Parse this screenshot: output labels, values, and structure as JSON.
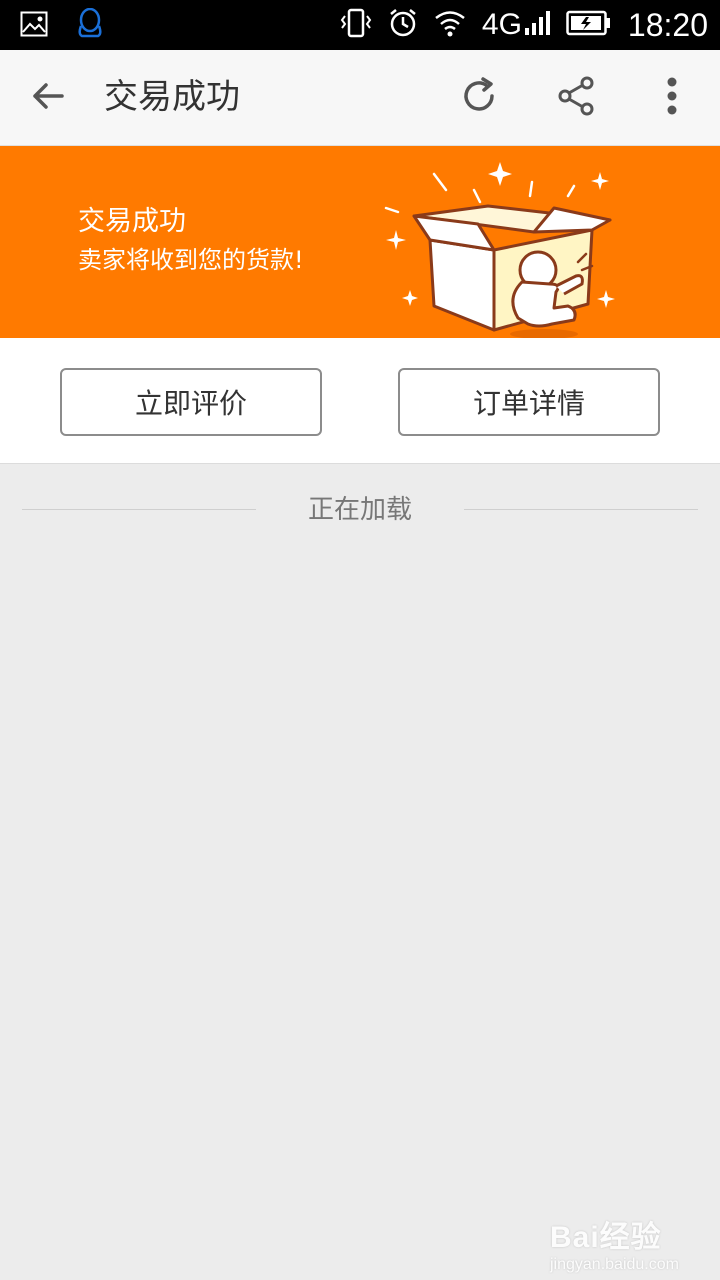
{
  "status_bar": {
    "time": "18:20",
    "network": "4G",
    "icons": [
      "image-icon",
      "qq-icon",
      "vibrate-icon",
      "alarm-icon",
      "wifi-icon",
      "signal-icon",
      "battery-icon"
    ]
  },
  "app_bar": {
    "title": "交易成功",
    "icons": [
      "back-arrow-icon",
      "refresh-icon",
      "share-icon",
      "more-vert-icon"
    ]
  },
  "banner": {
    "title": "交易成功",
    "subtitle": "卖家将收到您的货款!",
    "background_color": "#ff7a00",
    "illustration": "open-box-with-mascot"
  },
  "actions": {
    "review_label": "立即评价",
    "order_detail_label": "订单详情"
  },
  "loading": {
    "text": "正在加载"
  },
  "watermark": {
    "main": "Bai经验",
    "sub": "jingyan.baidu.com"
  }
}
